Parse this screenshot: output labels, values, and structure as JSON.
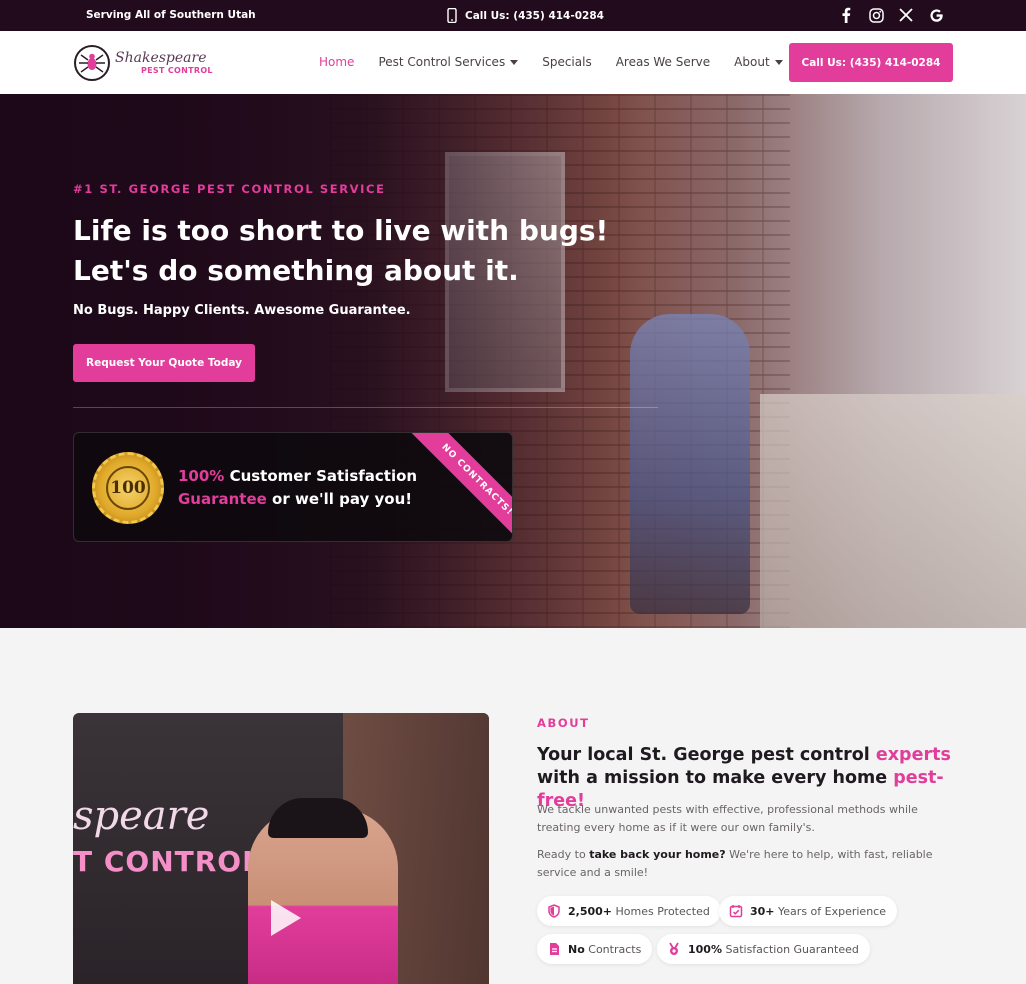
{
  "topbar": {
    "serving": "Serving All of Southern Utah",
    "phone": "Call Us: (435) 414-0284",
    "social": [
      "facebook-icon",
      "instagram-icon",
      "x-icon",
      "google-icon"
    ]
  },
  "nav": {
    "logo_line1": "Shakespeare",
    "logo_line2": "PEST CONTROL",
    "links": [
      {
        "label": "Home",
        "active": true
      },
      {
        "label": "Pest Control Services",
        "dropdown": true
      },
      {
        "label": "Specials"
      },
      {
        "label": "Areas We Serve"
      },
      {
        "label": "About",
        "dropdown": true
      }
    ],
    "cta": "Call Us: (435) 414-0284"
  },
  "hero": {
    "eyebrow": "#1 ST. GEORGE PEST CONTROL SERVICE",
    "title_line1": "Life is too short to live with bugs!",
    "title_line2": "Let's do something about it.",
    "subtitle": "No Bugs. Happy Clients. Awesome Guarantee.",
    "cta": "Request Your Quote Today",
    "guarantee": {
      "seal_number": "100",
      "line1_pink": "100%",
      "line1_rest": " Customer Satisfaction",
      "line2_pink": "Guarantee",
      "line2_rest": " or we'll pay you!",
      "ribbon": "NO CONTRACTS!"
    }
  },
  "about": {
    "eyebrow": "ABOUT",
    "title_a": "Your local St. George pest control ",
    "title_b": "experts",
    "title_c": " with a mission to make every home ",
    "title_d": "pest-free!",
    "p1": "We tackle unwanted pests with effective, professional methods while treating every home as if it were our own family's.",
    "p2_a": "Ready to ",
    "p2_b": "take back your home?",
    "p2_c": " We're here to help, with fast, reliable service and a smile!",
    "video_sign_1": "speare",
    "video_sign_2": "T CONTROL",
    "pills": [
      {
        "icon": "shield-icon",
        "bold": "2,500+",
        "text": " Homes Protected"
      },
      {
        "icon": "calendar-check-icon",
        "bold": "30+",
        "text": " Years of Experience"
      },
      {
        "icon": "document-icon",
        "bold": "No",
        "text": " Contracts"
      },
      {
        "icon": "medal-icon",
        "bold": "100%",
        "text": " Satisfaction Guaranteed"
      }
    ]
  },
  "colors": {
    "brand": "#e23d9b",
    "topbar": "#230b1e"
  }
}
